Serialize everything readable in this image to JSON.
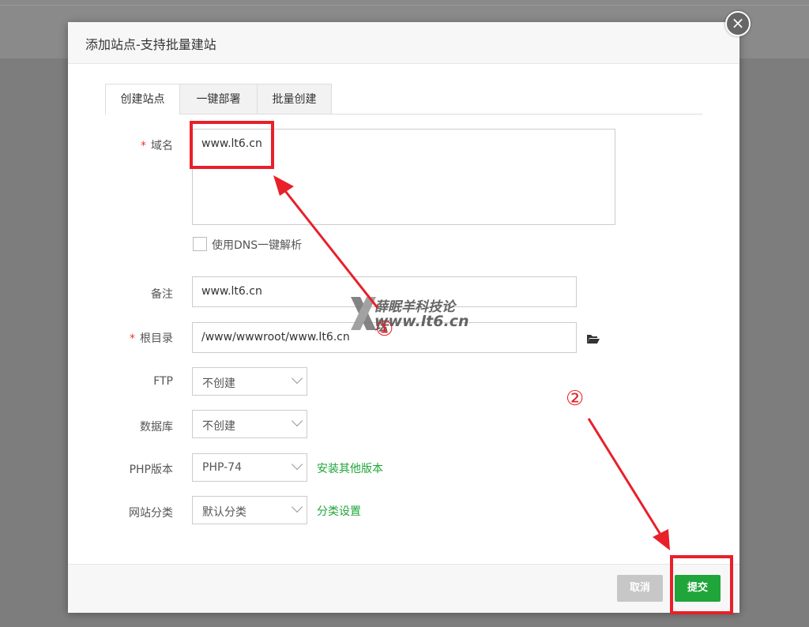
{
  "dialog": {
    "title": "添加站点-支持批量建站",
    "close_icon": "close-icon"
  },
  "tabs": [
    {
      "label": "创建站点",
      "active": true
    },
    {
      "label": "一键部署",
      "active": false
    },
    {
      "label": "批量创建",
      "active": false
    }
  ],
  "form": {
    "domain": {
      "label": "域名",
      "required": "*",
      "value": "www.lt6.cn"
    },
    "dns_checkbox": {
      "label": "使用DNS一键解析",
      "checked": false
    },
    "remark": {
      "label": "备注",
      "value": "www.lt6.cn"
    },
    "root": {
      "label": "根目录",
      "required": "*",
      "value": "/www/wwwroot/www.lt6.cn",
      "icon": "folder-open-icon"
    },
    "ftp": {
      "label": "FTP",
      "selected": "不创建"
    },
    "database": {
      "label": "数据库",
      "selected": "不创建"
    },
    "php": {
      "label": "PHP版本",
      "selected": "PHP-74",
      "link": "安装其他版本"
    },
    "category": {
      "label": "网站分类",
      "selected": "默认分类",
      "link": "分类设置"
    }
  },
  "footer": {
    "cancel_label": "取消",
    "submit_label": "提交"
  },
  "annotations": {
    "marker_1": "①",
    "marker_2": "②",
    "color": "#e8202a"
  },
  "watermark": {
    "line1": "薛眠羊科技论坛",
    "line2": "www.lt6.cn"
  },
  "colors": {
    "accent": "#20a53a",
    "cancel": "#c7c7c7",
    "required": "#e33"
  }
}
